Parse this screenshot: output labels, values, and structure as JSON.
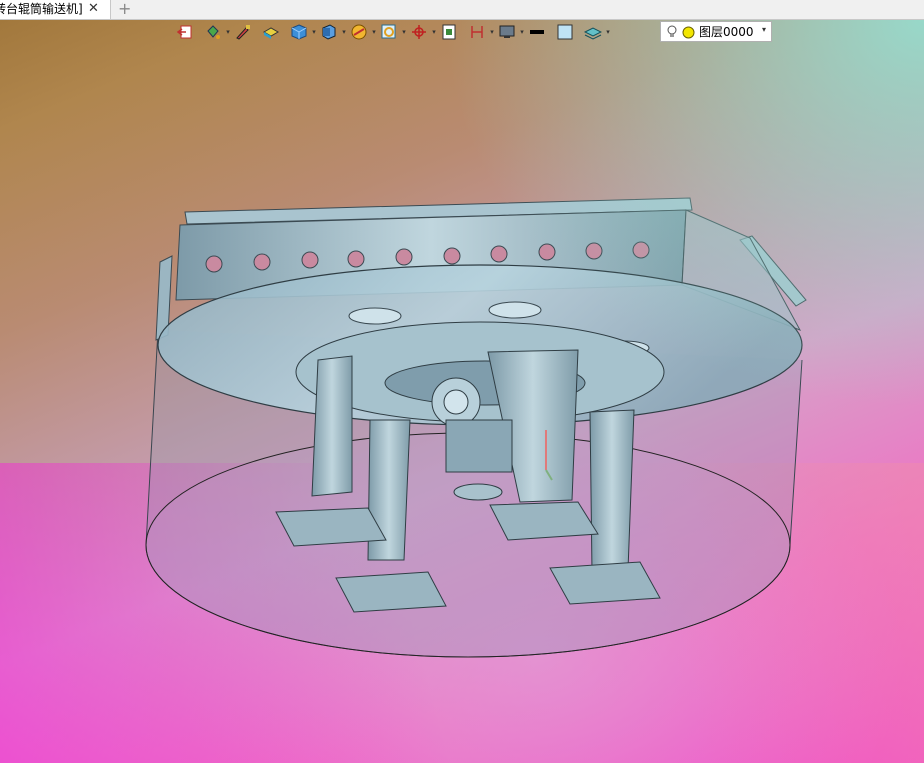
{
  "tab": {
    "title": "转台辊筒输送机]",
    "close_glyph": "✕",
    "new_glyph": "+"
  },
  "toolbar": {
    "tools": [
      {
        "name": "exit-sketch-icon",
        "has_dropdown": false
      },
      {
        "name": "paint-bucket-icon",
        "has_dropdown": true
      },
      {
        "name": "brush-icon",
        "has_dropdown": false
      },
      {
        "name": "render-style-icon",
        "has_dropdown": false
      },
      {
        "name": "shaded-cube-icon",
        "has_dropdown": true
      },
      {
        "name": "view-orientation-icon",
        "has_dropdown": true
      },
      {
        "name": "section-view-icon",
        "has_dropdown": true
      },
      {
        "name": "zoom-window-icon",
        "has_dropdown": true
      },
      {
        "name": "move-triad-icon",
        "has_dropdown": true
      },
      {
        "name": "fit-view-icon",
        "has_dropdown": false
      },
      {
        "name": "dimension-icon",
        "has_dropdown": true
      },
      {
        "name": "display-monitor-icon",
        "has_dropdown": true
      },
      {
        "name": "line-color-icon",
        "has_dropdown": false
      },
      {
        "name": "fill-color-icon",
        "has_dropdown": false
      },
      {
        "name": "layer-manager-icon",
        "has_dropdown": true
      }
    ],
    "dropdown_glyph": "▾"
  },
  "layer": {
    "value": "图层0000",
    "arrow": "▾",
    "bulb_icon": "bulb-icon",
    "dot_icon": "layer-dot-icon"
  }
}
